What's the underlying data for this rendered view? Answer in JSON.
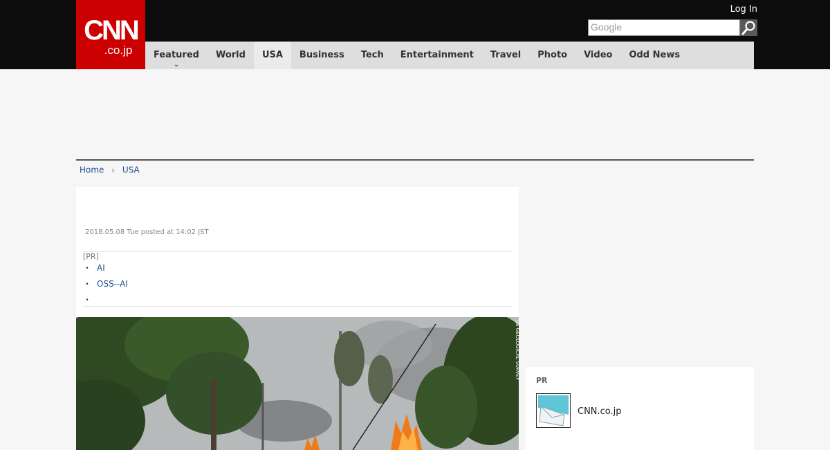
{
  "header": {
    "logo": {
      "main": "CNN",
      "sub": ".co.jp"
    },
    "login_label": "Log In",
    "search": {
      "placeholder": "Google"
    }
  },
  "nav": {
    "items": [
      {
        "label": "Featured",
        "active": false,
        "has_dropdown": true
      },
      {
        "label": "World",
        "active": false
      },
      {
        "label": "USA",
        "active": true
      },
      {
        "label": "Business",
        "active": false
      },
      {
        "label": "Tech",
        "active": false
      },
      {
        "label": "Entertainment",
        "active": false
      },
      {
        "label": "Travel",
        "active": false
      },
      {
        "label": "Photo",
        "active": false
      },
      {
        "label": "Video",
        "active": false
      },
      {
        "label": "Odd News",
        "active": false
      }
    ]
  },
  "breadcrumb": {
    "home": "Home",
    "current": "USA"
  },
  "article": {
    "date": "2018.05.08 Tue posted at 14:02 JST",
    "pr": {
      "label": "[PR]",
      "items": [
        {
          "text": "AI"
        },
        {
          "text": "OSS--AI"
        },
        {
          "text": ""
        }
      ]
    },
    "photo": {
      "icon": "photo-image-icon",
      "credit": "US GEOLOGICAL SURVEY"
    }
  },
  "sidebar": {
    "pr_box": {
      "heading": "PR",
      "item_label": "CNN.co.jp",
      "thumb_icon": "email-thumbnail-icon"
    }
  },
  "colors": {
    "brand_red": "#cc0000",
    "header_bg": "#0c0c0c",
    "nav_bg": "#dedede",
    "link_blue": "#1a4d8c"
  }
}
